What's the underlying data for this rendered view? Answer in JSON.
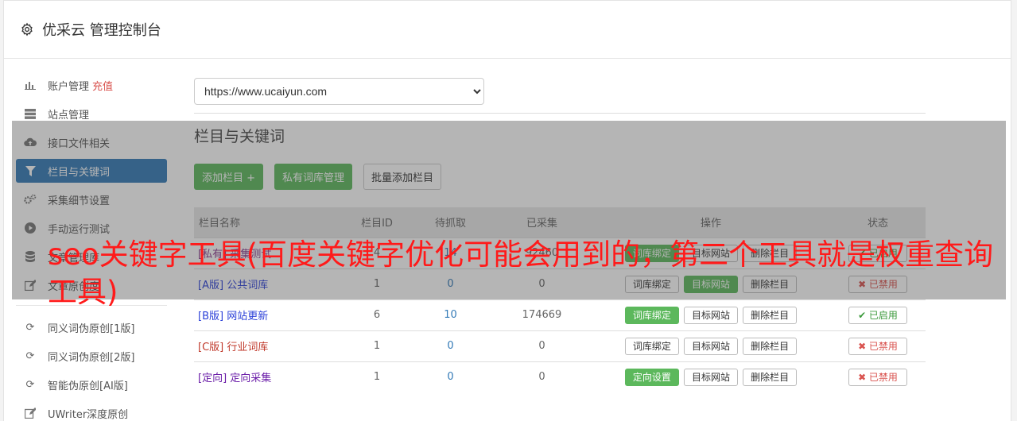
{
  "header": {
    "title": "优采云 管理控制台",
    "icon": "gear-icon"
  },
  "sidebar": {
    "items": [
      {
        "label": "账户管理",
        "extra": "充值",
        "icon": "bar-chart-icon"
      },
      {
        "label": "站点管理",
        "icon": "server-icon"
      },
      {
        "label": "接口文件相关",
        "icon": "cloud-upload-icon"
      },
      {
        "label": "栏目与关键词",
        "icon": "filter-icon",
        "active": true
      },
      {
        "label": "采集细节设置",
        "icon": "cogs-icon"
      },
      {
        "label": "手动运行测试",
        "icon": "play-circle-icon"
      },
      {
        "label": "文章管理库",
        "icon": "database-icon"
      },
      {
        "label": "文章原创度",
        "icon": "edit-icon"
      }
    ],
    "tools": [
      {
        "label": "同义词伪原创[1版]",
        "icon": "refresh-icon"
      },
      {
        "label": "同义词伪原创[2版]",
        "icon": "refresh-icon"
      },
      {
        "label": "智能伪原创[AI版]",
        "icon": "refresh-icon"
      },
      {
        "label": "UWriter深度原创",
        "icon": "edit-icon"
      }
    ]
  },
  "site_select": {
    "value": "https://www.ucaiyun.com"
  },
  "section": {
    "title": "栏目与关键词",
    "add_column": "添加栏目 +",
    "private_lib": "私有词库管理",
    "batch_add": "批量添加栏目"
  },
  "table": {
    "headers": [
      "栏目名称",
      "栏目ID",
      "待抓取",
      "已采集",
      "操作",
      "状态"
    ],
    "rows": [
      {
        "tag": "[私有]",
        "name": "采集测试",
        "id": "4",
        "pending": "14",
        "collected": "92460",
        "op1": "词库绑定",
        "op2": "目标网站",
        "op3": "删除栏目",
        "status": "✔ 已启用"
      },
      {
        "tag": "[A版]",
        "name": "公共词库",
        "id": "1",
        "pending": "0",
        "collected": "0",
        "op1": "词库绑定",
        "op2": "目标网站",
        "op3": "删除栏目",
        "status": "✖ 已禁用"
      },
      {
        "tag": "[B版]",
        "name": "网站更新",
        "id": "6",
        "pending": "10",
        "collected": "174669",
        "op1": "词库绑定",
        "op2": "目标网站",
        "op3": "删除栏目",
        "status": "✔ 已启用"
      },
      {
        "tag": "[C版]",
        "name": "行业词库",
        "id": "1",
        "pending": "0",
        "collected": "0",
        "op1": "词库绑定",
        "op2": "目标网站",
        "op3": "删除栏目",
        "status": "✖ 已禁用"
      },
      {
        "tag": "[定向]",
        "name": "定向采集",
        "id": "1",
        "pending": "0",
        "collected": "0",
        "op1": "定向设置",
        "op2": "目标网站",
        "op3": "删除栏目",
        "status": "✖ 已禁用"
      }
    ]
  },
  "banner": {
    "text": "seo关键字工具(百度关键字优化可能会用到的，第二个工具就是权重查询工具)"
  }
}
